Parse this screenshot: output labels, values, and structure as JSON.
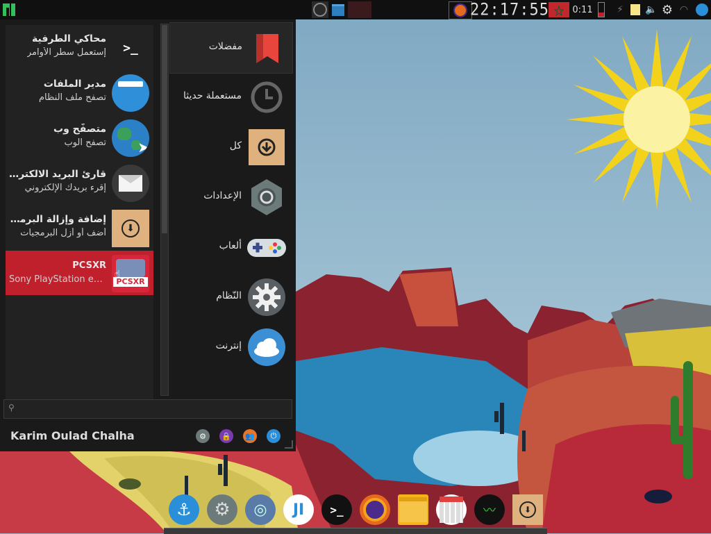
{
  "panel": {
    "clock": "22:17:55",
    "battery": "0:11"
  },
  "favorites": [
    {
      "title": "محاكي الطرفية",
      "subtitle": "إستعمل سطر الأوامر",
      "icon": "terminal-icon"
    },
    {
      "title": "مدير الملفات",
      "subtitle": "تصفح ملف النظام",
      "icon": "folder-icon"
    },
    {
      "title": "متصفّح وب",
      "subtitle": "تصفح الوب",
      "icon": "globe-icon"
    },
    {
      "title": "قارئ البريد الالكتروني",
      "subtitle": "إقرء بريدك الإلكتروني",
      "icon": "mail-icon"
    },
    {
      "title": "إضافة وإزالة البرمجيات",
      "subtitle": "أضف أو أزل البرمجيات",
      "icon": "package-icon"
    },
    {
      "title": "PCSXR",
      "subtitle": "Sony PlayStation emulator",
      "icon": "gamepad-icon"
    }
  ],
  "categories": [
    {
      "label": "مفضلات",
      "icon": "bookmark-icon"
    },
    {
      "label": "مستعملة حديثا",
      "icon": "clock-icon"
    },
    {
      "label": "كل",
      "icon": "package-icon"
    },
    {
      "label": "الإعدادات",
      "icon": "settings-icon"
    },
    {
      "label": "ألعاب",
      "icon": "gamepad-icon"
    },
    {
      "label": "النّظام",
      "icon": "gear-icon"
    },
    {
      "label": "إنترنت",
      "icon": "cloud-icon"
    }
  ],
  "search": {
    "placeholder": ""
  },
  "user": {
    "name": "Karim Oulad Chalha"
  },
  "colors": {
    "accent": "#c0202c",
    "panel": "#101010",
    "menu": "#1a1a1a"
  }
}
